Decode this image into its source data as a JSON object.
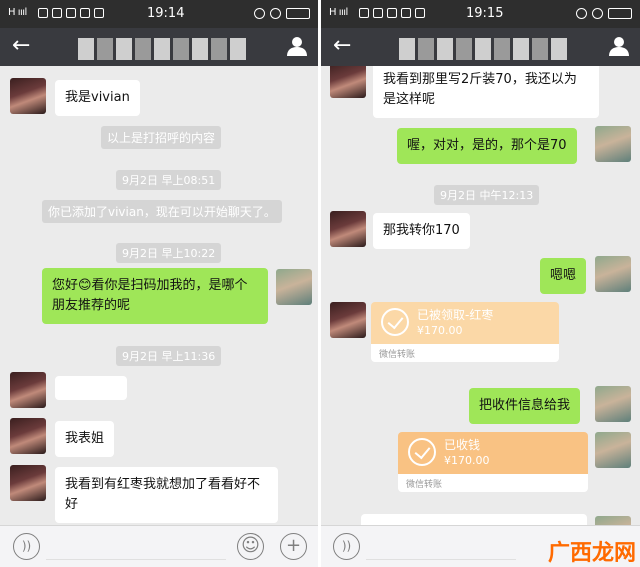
{
  "left": {
    "status": {
      "carrier": "H ıııl",
      "time": "19:14"
    },
    "messages": {
      "m1": "我是vivian",
      "sys1": "以上是打招呼的内容",
      "t1": "9月2日 早上08:51",
      "sys2": "你已添加了vivian，现在可以开始聊天了。",
      "t2": "9月2日 早上10:22",
      "m2": "您好😊看你是扫码加我的，是哪个朋友推荐的呢",
      "t3": "9月2日 早上11:36",
      "m3": "我表姐",
      "m4": "我看到有红枣我就想加了看看好不好"
    }
  },
  "right": {
    "status": {
      "carrier": "H ıııl",
      "time": "19:15"
    },
    "messages": {
      "m1": "我看到那里写2斤装70，我还以为是这样呢",
      "m2": "喔，对对，是的，那个是70",
      "t1": "9月2日 中午12:13",
      "m3": "那我转你170",
      "m4": "嗯嗯",
      "card1_title": "已被领取-红枣",
      "card1_amount": "¥170.00",
      "card1_footer": "微信转账",
      "m5": "把收件信息给我",
      "card2_title": "已收钱",
      "card2_amount": "¥170.00",
      "card2_footer": "微信转账"
    }
  },
  "watermark": "广西龙网",
  "icons": [
    "back-arrow-icon",
    "person-icon",
    "voice-icon",
    "emoji-icon",
    "plus-icon",
    "smile-emoji-icon",
    "check-circle-icon"
  ]
}
